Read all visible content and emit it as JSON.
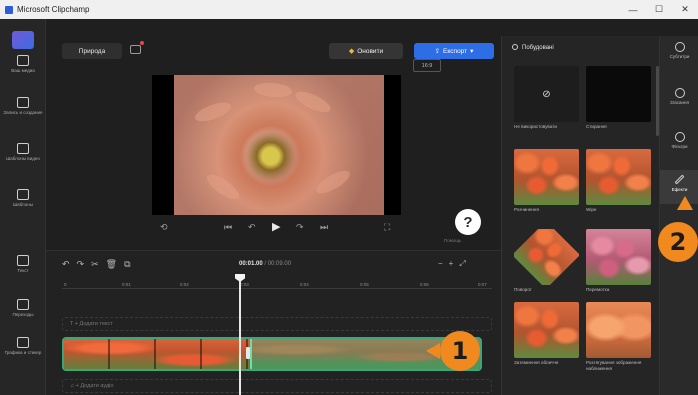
{
  "window": {
    "title": "Microsoft Clipchamp",
    "controls": [
      "—",
      "☐",
      "✕"
    ]
  },
  "leftrail": {
    "items": [
      {
        "label": "Ваш медиа",
        "icon": "folder-icon"
      },
      {
        "label": "Запись и создание",
        "icon": "camera-icon"
      },
      {
        "label": "Шаблоны видео",
        "icon": "template-icon"
      },
      {
        "label": "Шаблоны",
        "icon": "grid-icon"
      },
      {
        "label": "Текст",
        "icon": "text-icon"
      },
      {
        "label": "Переходы",
        "icon": "transition-icon"
      },
      {
        "label": "Графика и стикер",
        "icon": "shapes-icon"
      }
    ]
  },
  "toolbar": {
    "project_name": "Природа",
    "upgrade_label": "Оновити",
    "export_label": "Експорт",
    "aspect_ratio": "16:9"
  },
  "player": {
    "controls": [
      "⟲",
      "⏮",
      "↶",
      "▶",
      "↷",
      "⏭",
      "⛶"
    ]
  },
  "help": {
    "label": "?",
    "sublabel": "Помощь"
  },
  "timeline": {
    "time_current": "00:01.00",
    "time_total": "/ 00:09.00",
    "ruler_ticks": [
      "0",
      "0:01",
      "0:02",
      "0:03",
      "0:04",
      "0:05",
      "0:06",
      "0:07"
    ],
    "text_row_label": "T + Додати текст",
    "audio_row_label": "♫ + Додати аудіо"
  },
  "transitions_panel": {
    "title": "Побудовані",
    "items": [
      {
        "label": "Не використовувати",
        "style": "none"
      },
      {
        "label": "Стирання",
        "style": "black"
      },
      {
        "label": "Розчинення",
        "style": "tulips"
      },
      {
        "label": "Wipe",
        "style": "tulips"
      },
      {
        "label": "Поворот",
        "style": "tulips-rotated"
      },
      {
        "label": "Перемотка",
        "style": "tulips-pink"
      },
      {
        "label": "Затемнення обличчя",
        "style": "tulips"
      },
      {
        "label": "Розтягування зображення наближення",
        "style": "tulips-close"
      }
    ]
  },
  "rightrail": {
    "items": [
      {
        "label": "Субтитри",
        "icon": "captions-icon"
      },
      {
        "label": "Згасання",
        "icon": "fade-icon"
      },
      {
        "label": "Фільтри",
        "icon": "filters-icon"
      },
      {
        "label": "Ефекти",
        "icon": "effects-wand-icon",
        "active": true
      }
    ]
  },
  "callouts": {
    "one": "1",
    "two": "2"
  },
  "colors": {
    "accent": "#2d6ee6",
    "callout": "#f08a1f",
    "clip_selected": "#3aa679"
  }
}
